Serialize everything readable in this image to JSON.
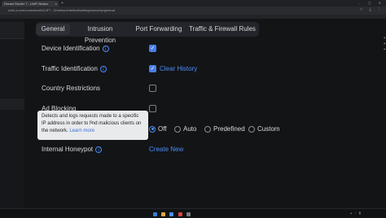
{
  "browser": {
    "tab_title": "Dream Router 7 - UniFi Netwo",
    "tab_close": "×",
    "new_tab": "+",
    "window_controls": "– ▢ ✕",
    "url": "unifi.ui.com/consoles/84C4F7...S/network/default/settings/security/general",
    "url_icons": "☆ ⤓ ⋮"
  },
  "tabs": {
    "general": "General",
    "intrusion_prevention": "Intrusion Prevention",
    "port_forwarding": "Port Forwarding",
    "traffic_firewall_rules": "Traffic & Firewall Rules"
  },
  "rows": {
    "device_identification": "Device Identification",
    "traffic_identification": "Traffic Identification",
    "clear_history": "Clear History",
    "country_restrictions": "Country Restrictions",
    "ad_blocking": "Ad Blocking",
    "internal_honeypot": "Internal Honeypot",
    "create_new": "Create New"
  },
  "radios": {
    "off": "Off",
    "auto": "Auto",
    "predefined": "Predefined",
    "custom": "Custom"
  },
  "tooltip": {
    "text": "Detects and logs requests made to a specific IP address in order to find malicious clients on the network.",
    "link": "Learn more"
  },
  "icons": {
    "info": "i",
    "check": "✓"
  },
  "taskbar": {
    "clock_time": "",
    "clock_date": ""
  },
  "colors": {
    "accent": "#4b8df8",
    "checkbox_on": "#4a7ee8",
    "background": "#131416"
  }
}
